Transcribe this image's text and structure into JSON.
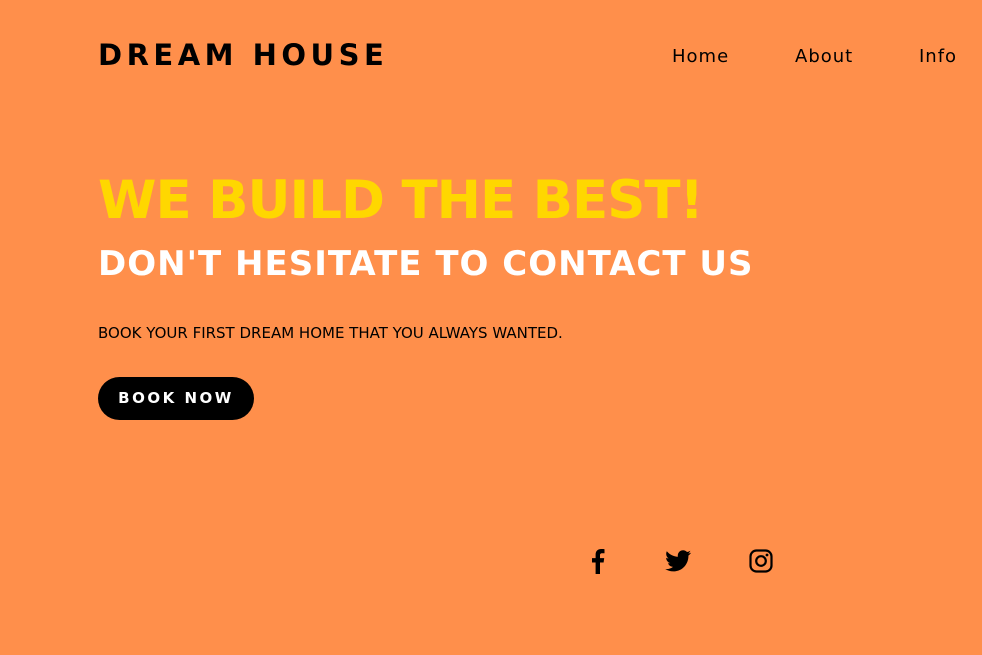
{
  "header": {
    "logo": "DREAM HOUSE",
    "nav": [
      {
        "label": "Home"
      },
      {
        "label": "About"
      },
      {
        "label": "Info"
      }
    ]
  },
  "hero": {
    "headline": "WE BUILD THE BEST!",
    "subheadline": "DON'T HESITATE TO CONTACT US",
    "tagline": "BOOK YOUR FIRST DREAM HOME THAT YOU ALWAYS WANTED.",
    "cta_label": "BOOK NOW"
  },
  "social": [
    {
      "icon": "facebook-icon"
    },
    {
      "icon": "twitter-icon"
    },
    {
      "icon": "instagram-icon"
    }
  ],
  "colors": {
    "background": "#FF8F4B",
    "headline": "#FFD700",
    "subheadline": "#FFFFFF",
    "text": "#000000",
    "button_bg": "#000000",
    "button_text": "#FFFFFF"
  }
}
